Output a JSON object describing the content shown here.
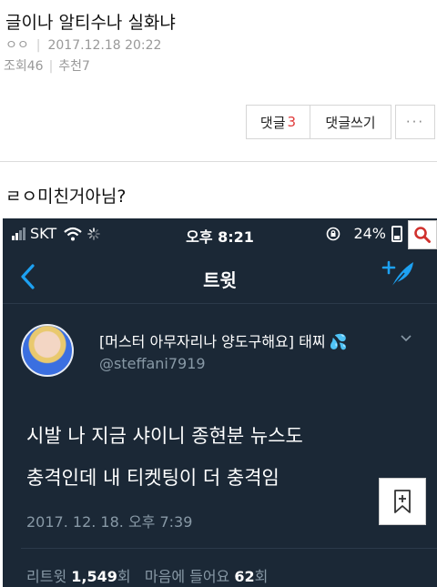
{
  "post": {
    "title": "글이나 알티수나 실화냐",
    "author": "ㅇㅇ",
    "date": "2017.12.18 20:22",
    "views_label": "조회46",
    "recommend_label": "추천7",
    "body": "ㄹㅇ미친거아님?"
  },
  "buttons": {
    "comments_label": "댓글",
    "comments_count": "3",
    "write_label": "댓글쓰기",
    "more_label": "···"
  },
  "phone": {
    "carrier": "SKT",
    "time": "오후 8:21",
    "battery": "24%",
    "nav_title": "트윗"
  },
  "tweet": {
    "author_name": "[머스터 아무자리나 양도구해요] 태찌",
    "handle": "@steffani7919",
    "text_line1": "시발 나 지금 샤이니 종현분 뉴스도",
    "text_line2": "충격인데 내 티켓팅이 더 충격임",
    "date": "2017. 12. 18. 오후 7:39",
    "retweet_label": "리트윗",
    "retweet_count": "1,549",
    "times_unit": "회",
    "likes_label": "마음에 들어요",
    "likes_count": "62"
  },
  "colors": {
    "accent_red": "#e03a3a",
    "twitter_blue": "#1da1f2",
    "dark_bg": "#1b2836"
  },
  "icons": [
    "wifi-icon",
    "spinner-icon",
    "lock-rotation-icon",
    "battery-icon",
    "search-icon",
    "back-chevron-icon",
    "compose-icon",
    "water-drops-icon",
    "chevron-down-icon",
    "bookmark-icon"
  ]
}
